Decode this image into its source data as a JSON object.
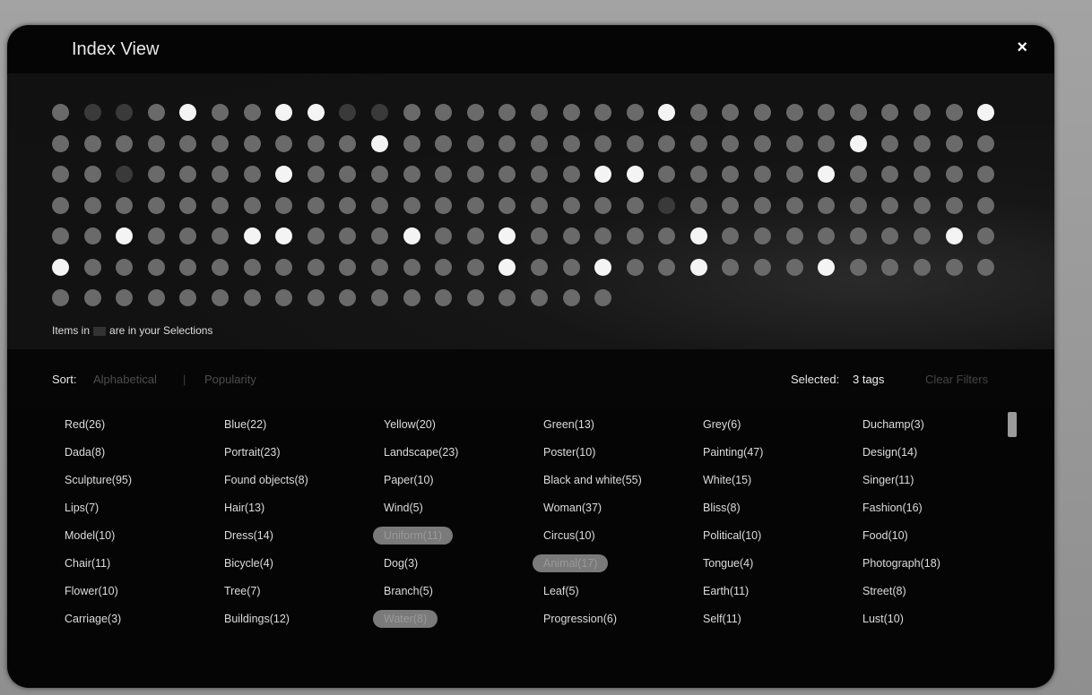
{
  "dialog": {
    "title": "Index View",
    "close_label": "×"
  },
  "dots": {
    "caption_before": "Items in",
    "caption_after": "are in your Selections",
    "rows": [
      [
        "n",
        "d",
        "d",
        "n",
        "b",
        "n",
        "n",
        "b",
        "b",
        "d",
        "d",
        "n",
        "n",
        "n",
        "n",
        "n",
        "n",
        "n",
        "n",
        "b",
        "n",
        "n",
        "n",
        "n",
        "n",
        "n",
        "n",
        "n",
        "n",
        "b"
      ],
      [
        "n",
        "n",
        "n",
        "n",
        "n",
        "n",
        "n",
        "n",
        "n",
        "n",
        "b",
        "n",
        "n",
        "n",
        "n",
        "n",
        "n",
        "n",
        "n",
        "n",
        "n",
        "n",
        "n",
        "n",
        "n",
        "b",
        "n",
        "n",
        "n",
        "n"
      ],
      [
        "n",
        "n",
        "d",
        "n",
        "n",
        "n",
        "n",
        "b",
        "n",
        "n",
        "n",
        "n",
        "n",
        "n",
        "n",
        "n",
        "n",
        "b",
        "b",
        "n",
        "n",
        "n",
        "n",
        "n",
        "b",
        "n",
        "n",
        "n",
        "n",
        "n"
      ],
      [
        "n",
        "n",
        "n",
        "n",
        "n",
        "n",
        "n",
        "n",
        "n",
        "n",
        "n",
        "n",
        "n",
        "n",
        "n",
        "n",
        "n",
        "n",
        "n",
        "d",
        "n",
        "n",
        "n",
        "n",
        "n",
        "n",
        "n",
        "n",
        "n",
        "n"
      ],
      [
        "n",
        "n",
        "b",
        "n",
        "n",
        "n",
        "b",
        "b",
        "n",
        "n",
        "n",
        "b",
        "n",
        "n",
        "b",
        "n",
        "n",
        "n",
        "n",
        "n",
        "b",
        "n",
        "n",
        "n",
        "n",
        "n",
        "n",
        "n",
        "b",
        "n"
      ],
      [
        "b",
        "n",
        "n",
        "n",
        "n",
        "n",
        "n",
        "n",
        "n",
        "n",
        "n",
        "n",
        "n",
        "n",
        "b",
        "n",
        "n",
        "b",
        "n",
        "n",
        "b",
        "n",
        "n",
        "n",
        "b",
        "n",
        "n",
        "n",
        "n",
        "n"
      ],
      [
        "n",
        "n",
        "n",
        "n",
        "n",
        "n",
        "n",
        "n",
        "n",
        "n",
        "n",
        "n",
        "n",
        "n",
        "n",
        "n",
        "n",
        "n"
      ]
    ]
  },
  "sort": {
    "label": "Sort:",
    "alphabetical": "Alphabetical",
    "separator": "|",
    "popularity": "Popularity"
  },
  "selection": {
    "label": "Selected:",
    "value": "3 tags",
    "clear_label": "Clear Filters"
  },
  "tags": [
    {
      "label": "Red(26)",
      "selected": false
    },
    {
      "label": "Blue(22)",
      "selected": false
    },
    {
      "label": "Yellow(20)",
      "selected": false
    },
    {
      "label": "Green(13)",
      "selected": false
    },
    {
      "label": "Grey(6)",
      "selected": false
    },
    {
      "label": "Duchamp(3)",
      "selected": false
    },
    {
      "label": "Dada(8)",
      "selected": false
    },
    {
      "label": "Portrait(23)",
      "selected": false
    },
    {
      "label": "Landscape(23)",
      "selected": false
    },
    {
      "label": "Poster(10)",
      "selected": false
    },
    {
      "label": "Painting(47)",
      "selected": false
    },
    {
      "label": "Design(14)",
      "selected": false
    },
    {
      "label": "Sculpture(95)",
      "selected": false
    },
    {
      "label": "Found objects(8)",
      "selected": false
    },
    {
      "label": "Paper(10)",
      "selected": false
    },
    {
      "label": "Black and white(55)",
      "selected": false
    },
    {
      "label": "White(15)",
      "selected": false
    },
    {
      "label": "Singer(11)",
      "selected": false
    },
    {
      "label": "Lips(7)",
      "selected": false
    },
    {
      "label": "Hair(13)",
      "selected": false
    },
    {
      "label": "Wind(5)",
      "selected": false
    },
    {
      "label": "Woman(37)",
      "selected": false
    },
    {
      "label": "Bliss(8)",
      "selected": false
    },
    {
      "label": "Fashion(16)",
      "selected": false
    },
    {
      "label": "Model(10)",
      "selected": false
    },
    {
      "label": "Dress(14)",
      "selected": false
    },
    {
      "label": "Uniform(11)",
      "selected": true
    },
    {
      "label": "Circus(10)",
      "selected": false
    },
    {
      "label": "Political(10)",
      "selected": false
    },
    {
      "label": "Food(10)",
      "selected": false
    },
    {
      "label": "Chair(11)",
      "selected": false
    },
    {
      "label": "Bicycle(4)",
      "selected": false
    },
    {
      "label": "Dog(3)",
      "selected": false
    },
    {
      "label": "Animal(17)",
      "selected": true
    },
    {
      "label": "Tongue(4)",
      "selected": false
    },
    {
      "label": "Photograph(18)",
      "selected": false
    },
    {
      "label": "Flower(10)",
      "selected": false
    },
    {
      "label": "Tree(7)",
      "selected": false
    },
    {
      "label": "Branch(5)",
      "selected": false
    },
    {
      "label": "Leaf(5)",
      "selected": false
    },
    {
      "label": "Earth(11)",
      "selected": false
    },
    {
      "label": "Street(8)",
      "selected": false
    },
    {
      "label": "Carriage(3)",
      "selected": false
    },
    {
      "label": "Buildings(12)",
      "selected": false
    },
    {
      "label": "Water(8)",
      "selected": true
    },
    {
      "label": "Progression(6)",
      "selected": false
    },
    {
      "label": "Self(11)",
      "selected": false
    },
    {
      "label": "Lust(10)",
      "selected": false
    }
  ]
}
